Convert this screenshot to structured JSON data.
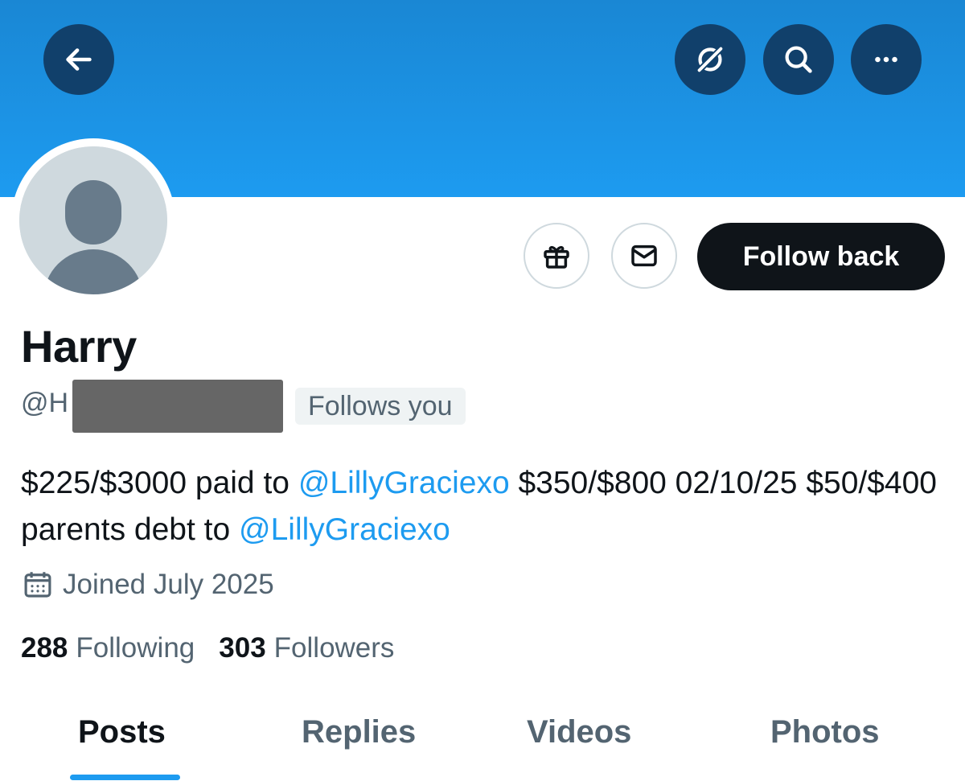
{
  "colors": {
    "banner": "#1d9bf0",
    "accent": "#1d9bf0",
    "text_primary": "#0f1419",
    "text_secondary": "#536471",
    "button_dark": "#0f1419"
  },
  "header": {
    "back_icon": "arrow-left-icon",
    "grok_icon": "grok-icon",
    "search_icon": "search-icon",
    "more_icon": "more-horizontal-icon"
  },
  "actions": {
    "gift_icon": "gift-icon",
    "message_icon": "envelope-icon",
    "follow_label": "Follow back"
  },
  "profile": {
    "display_name": "Harry",
    "handle_prefix": "@H",
    "follows_you": "Follows you",
    "bio": {
      "part1": "$225/$3000 paid to ",
      "mention1": "@LillyGraciexo",
      "part2": " $350/$800 02/10/25 $50/$400 parents debt to ",
      "mention2": "@LillyGraciexo"
    },
    "joined_icon": "calendar-icon",
    "joined": "Joined July 2025",
    "following_count": "288",
    "following_label": "Following",
    "followers_count": "303",
    "followers_label": "Followers"
  },
  "tabs": [
    {
      "label": "Posts",
      "active": true
    },
    {
      "label": "Replies",
      "active": false
    },
    {
      "label": "Videos",
      "active": false
    },
    {
      "label": "Photos",
      "active": false
    }
  ]
}
